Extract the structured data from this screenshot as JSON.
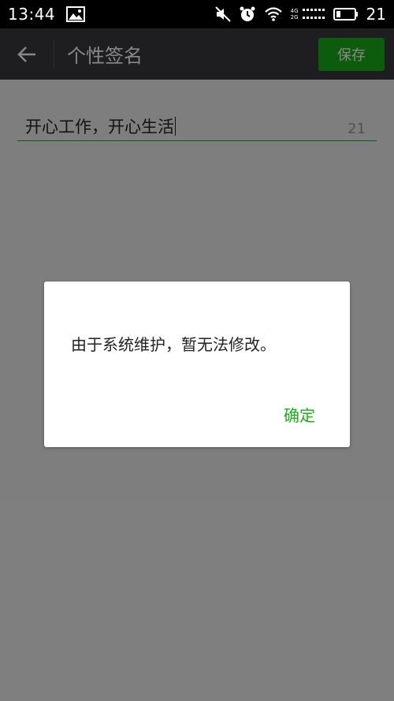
{
  "status_bar": {
    "time": "13:44",
    "network_labels": [
      "4G",
      "2G"
    ],
    "battery_level": "21",
    "icons": [
      "image-icon",
      "mute-icon",
      "alarm-icon",
      "wifi-icon",
      "signal-icon",
      "battery-icon"
    ]
  },
  "header": {
    "back_icon": "back-arrow-icon",
    "title": "个性签名",
    "save_label": "保存"
  },
  "signature": {
    "value": "开心工作，开心生活",
    "remaining_count": "21"
  },
  "dialog": {
    "message": "由于系统维护，暂无法修改。",
    "confirm_label": "确定"
  },
  "colors": {
    "accent": "#1aad19",
    "header_bg": "#393a3f",
    "status_bg": "#000000",
    "content_bg": "#efefef"
  }
}
